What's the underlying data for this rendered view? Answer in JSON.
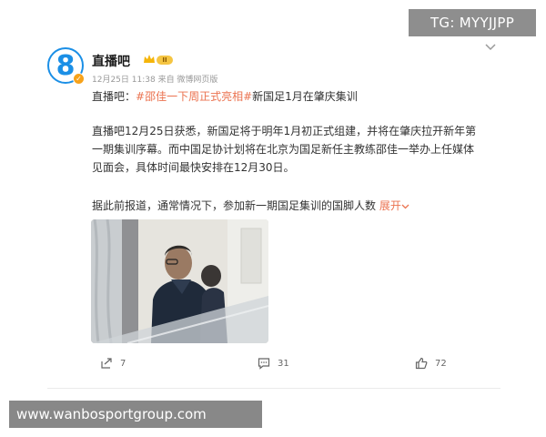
{
  "post": {
    "avatar_glyph": "8",
    "username": "直播吧",
    "level_badge": "II",
    "meta": "12月25日 11:38  来自 微博网页版",
    "line1_prefix": "直播吧：",
    "hashtag": "#邵佳一下周正式亮相#",
    "line1_suffix": "新国足1月在肇庆集训",
    "paragraph1": "直播吧12月25日获悉，新国足将于明年1月初正式组建，并将在肇庆拉开新年第一期集训序幕。而中国足协计划将在北京为国足新任主教练邵佳一举办上任媒体见面会，具体时间最快安排在12月30日。",
    "paragraph2": "据此前报道，通常情况下，参加新一期国足集训的国脚人数",
    "expand_label": "展开"
  },
  "actions": {
    "repost_count": "7",
    "comment_count": "31",
    "like_count": "72"
  },
  "overlays": {
    "top_right": "TG: MYYJJPP",
    "bottom_left": "www.wanbosportgroup.com"
  },
  "colors": {
    "accent_orange": "#eb7350",
    "avatar_blue": "#1b8fe6"
  }
}
